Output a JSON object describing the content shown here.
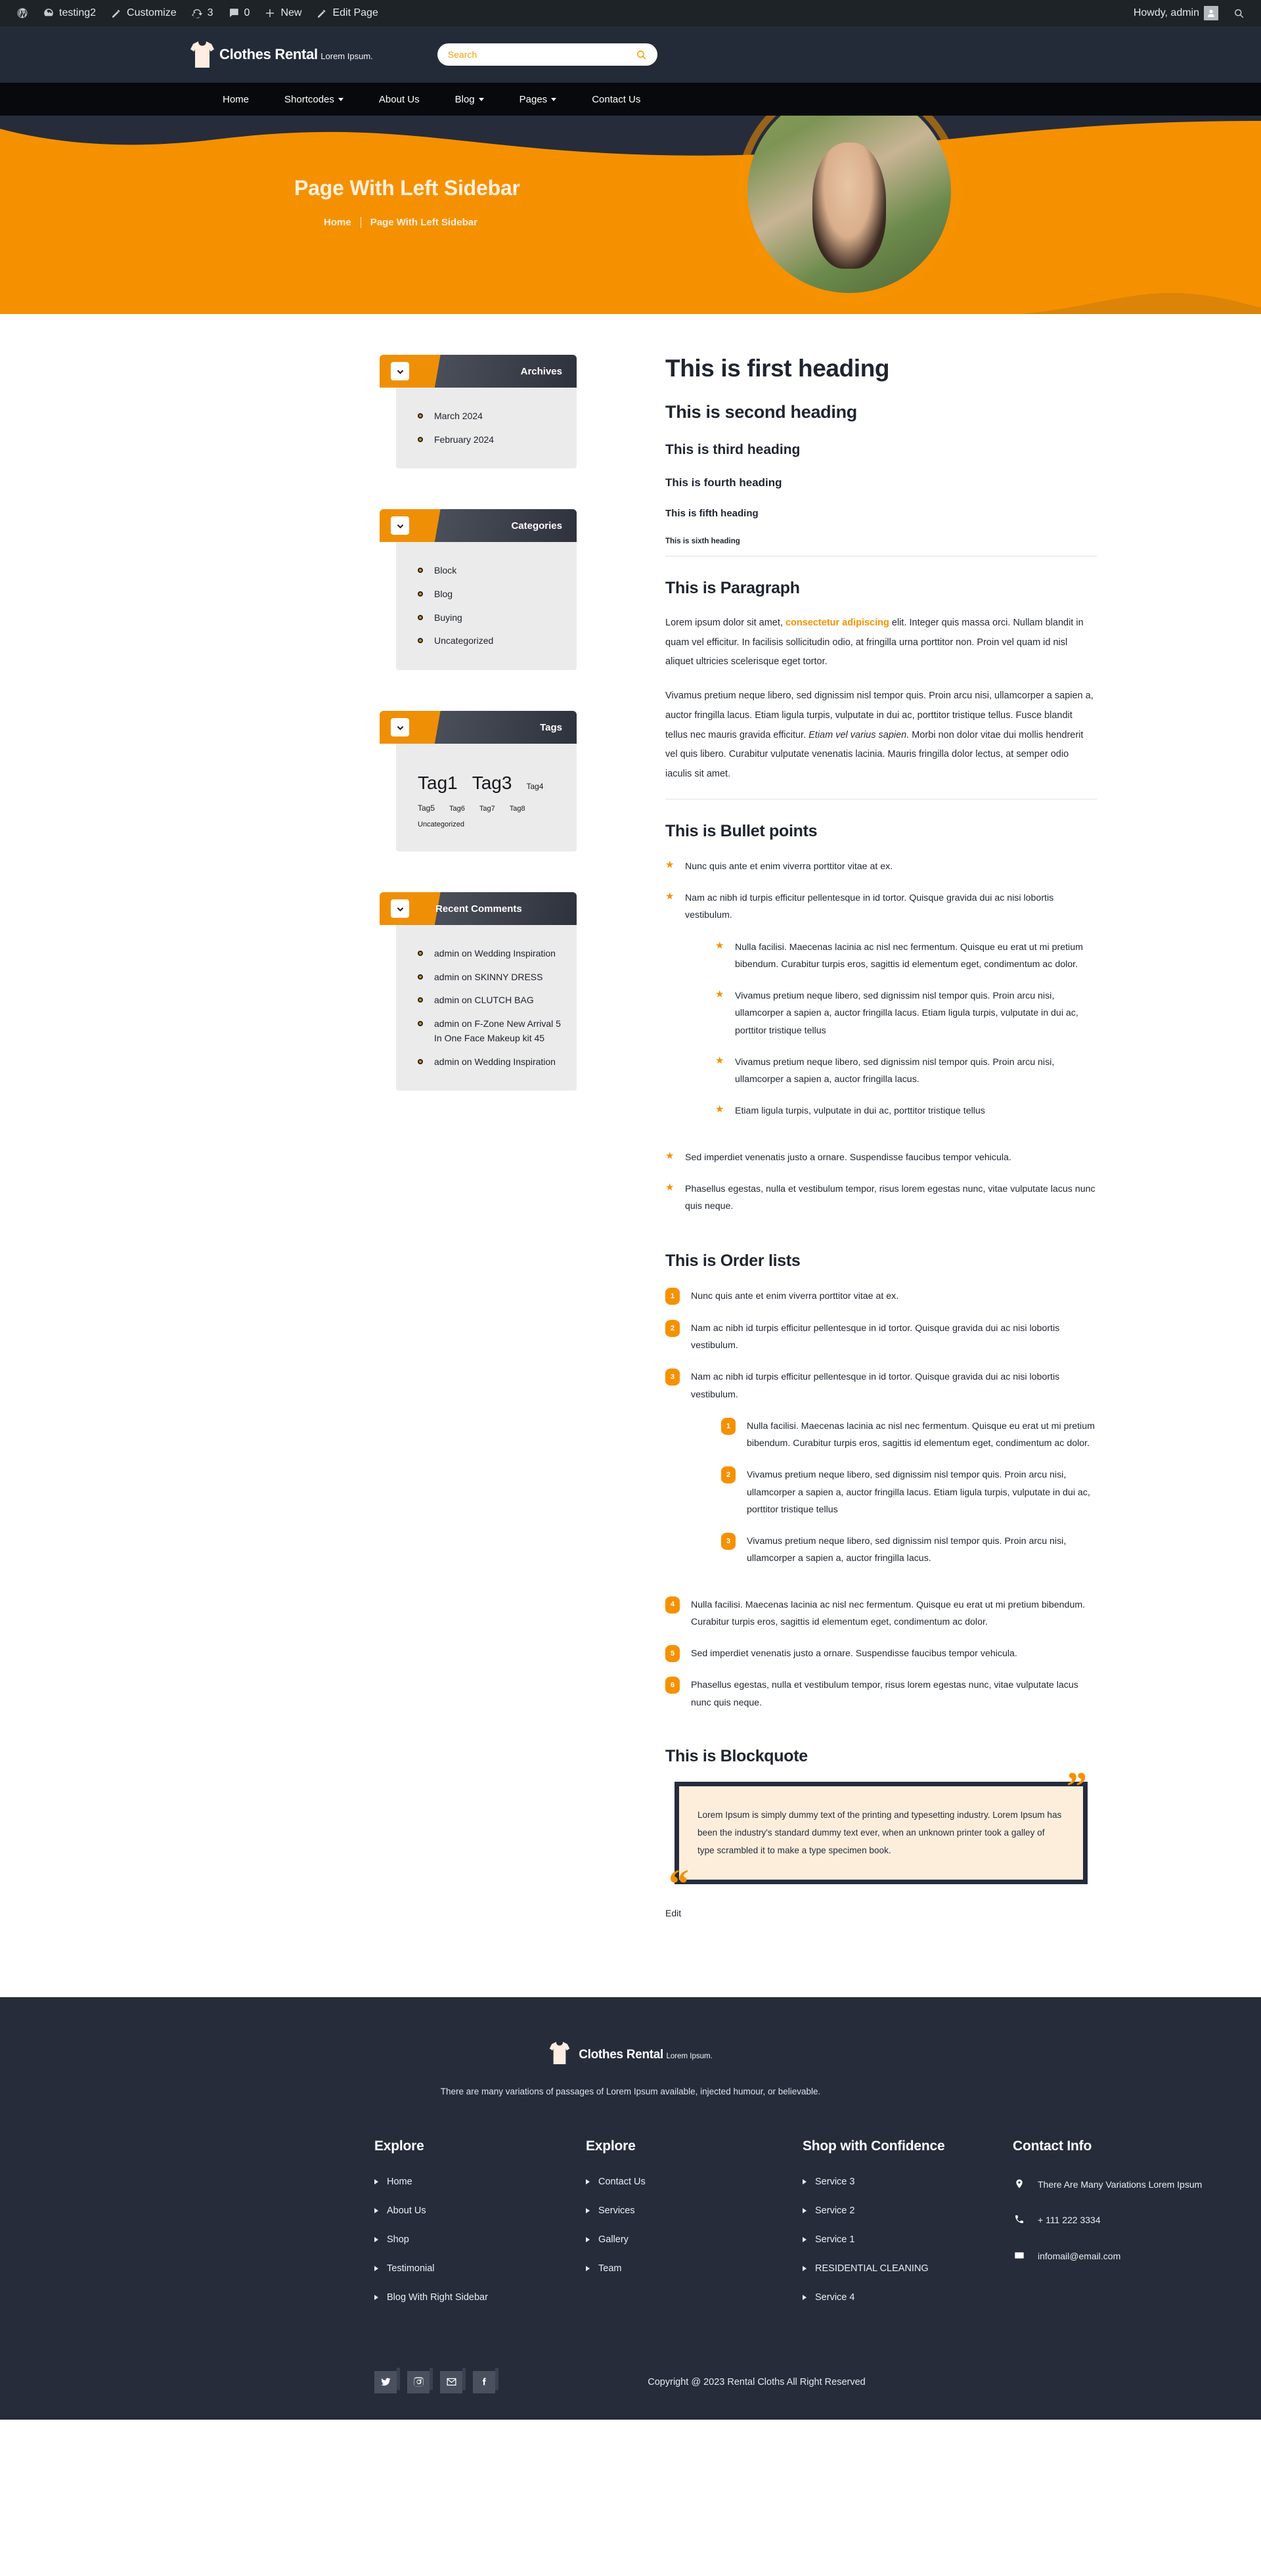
{
  "adminbar": {
    "left": [
      {
        "icon": "wordpress-icon",
        "label": ""
      },
      {
        "icon": "dashboard-icon",
        "label": "testing2"
      },
      {
        "icon": "pencil-icon",
        "label": "Customize"
      },
      {
        "icon": "refresh-icon",
        "label": "3"
      },
      {
        "icon": "comment-icon",
        "label": "0"
      },
      {
        "icon": "plus-icon",
        "label": "New"
      },
      {
        "icon": "edit-icon",
        "label": "Edit Page"
      }
    ],
    "howdy": "Howdy, admin"
  },
  "header": {
    "logo_title": "Clothes Rental",
    "logo_sub": "Lorem Ipsum.",
    "search_placeholder": "Search",
    "search_value": ""
  },
  "nav": {
    "items": [
      {
        "label": "Home",
        "has_caret": false
      },
      {
        "label": "Shortcodes",
        "has_caret": true
      },
      {
        "label": "About Us",
        "has_caret": false
      },
      {
        "label": "Blog",
        "has_caret": true
      },
      {
        "label": "Pages",
        "has_caret": true
      },
      {
        "label": "Contact Us",
        "has_caret": false
      }
    ]
  },
  "hero": {
    "title": "Page With Left Sidebar",
    "crumb_home": "Home",
    "crumb_current": "Page With Left Sidebar"
  },
  "sidebar": {
    "archives": {
      "title": "Archives",
      "items": [
        "March 2024",
        "February 2024"
      ]
    },
    "categories": {
      "title": "Categories",
      "items": [
        "Block",
        "Blog",
        "Buying",
        "Uncategorized"
      ]
    },
    "tags": {
      "title": "Tags",
      "items": [
        {
          "label": "Tag1",
          "size": 28
        },
        {
          "label": "Tag3",
          "size": 28
        },
        {
          "label": "Tag4",
          "size": 12
        },
        {
          "label": "Tag5",
          "size": 12
        },
        {
          "label": "Tag6",
          "size": 11
        },
        {
          "label": "Tag7",
          "size": 11
        },
        {
          "label": "Tag8",
          "size": 11
        },
        {
          "label": "Uncategorized",
          "size": 11
        }
      ]
    },
    "recent_comments": {
      "title": "Recent Comments",
      "items": [
        "admin on Wedding Inspiration",
        "admin on SKINNY DRESS",
        "admin on CLUTCH BAG",
        "admin on F-Zone New Arrival 5 In One Face Makeup kit 45",
        "admin on Wedding Inspiration"
      ]
    }
  },
  "content": {
    "h1": "This is first heading",
    "h2": "This is second heading",
    "h3": "This is third heading",
    "h4": "This is fourth heading",
    "h5": "This is fifth heading",
    "h6": "This is sixth heading",
    "paragraph_title": "This is Paragraph",
    "p1_a": "Lorem ipsum dolor sit amet, ",
    "p1_hl": "consectetur adipiscing",
    "p1_b": " elit. Integer quis massa orci. Nullam blandit in quam vel efficitur. In facilisis sollicitudin odio, at fringilla urna porttitor non. Proin vel quam id nisl aliquet ultricies scelerisque eget tortor.",
    "p2_a": "Vivamus pretium neque libero, sed dignissim nisl tempor quis. Proin arcu nisi, ullamcorper a sapien a, auctor fringilla lacus. Etiam ligula turpis, vulputate in dui ac, porttitor tristique tellus. Fusce blandit tellus nec mauris gravida efficitur. ",
    "p2_ital": "Etiam vel varius sapien.",
    "p2_b": " Morbi non dolor vitae dui mollis hendrerit vel quis libero. Curabitur vulputate venenatis lacinia. Mauris fringilla dolor lectus, at semper odio iaculis sit amet.",
    "bullet_title": "This is Bullet points",
    "bullets": {
      "b1": "Nunc quis ante et enim viverra porttitor vitae at ex.",
      "b2": "Nam ac nibh id turpis efficitur pellentesque in id tortor. Quisque gravida dui ac nisi lobortis vestibulum.",
      "sub1": "Nulla facilisi. Maecenas lacinia ac nisl nec fermentum. Quisque eu erat ut mi pretium bibendum. Curabitur turpis eros, sagittis id elementum eget, condimentum ac dolor.",
      "sub2": "Vivamus pretium neque libero, sed dignissim nisl tempor quis. Proin arcu nisi, ullamcorper a sapien a, auctor fringilla lacus. Etiam ligula turpis, vulputate in dui ac, porttitor tristique tellus",
      "sub3": "Vivamus pretium neque libero, sed dignissim nisl tempor quis. Proin arcu nisi, ullamcorper a sapien a, auctor fringilla lacus.",
      "sub4": "Etiam ligula turpis, vulputate in dui ac, porttitor tristique tellus",
      "b3": "Sed imperdiet venenatis justo a ornare. Suspendisse faucibus tempor vehicula.",
      "b4": "Phasellus egestas, nulla et vestibulum tempor, risus lorem egestas nunc, vitae vulputate lacus nunc quis neque."
    },
    "order_title": "This is Order lists",
    "orders": {
      "o1": "Nunc quis ante et enim viverra porttitor vitae at ex.",
      "o2": "Nam ac nibh id turpis efficitur pellentesque in id tortor. Quisque gravida dui ac nisi lobortis vestibulum.",
      "o3": "Nam ac nibh id turpis efficitur pellentesque in id tortor. Quisque gravida dui ac nisi lobortis vestibulum.",
      "sub1": "Nulla facilisi. Maecenas lacinia ac nisl nec fermentum. Quisque eu erat ut mi pretium bibendum. Curabitur turpis eros, sagittis id elementum eget, condimentum ac dolor.",
      "sub2": "Vivamus pretium neque libero, sed dignissim nisl tempor quis. Proin arcu nisi, ullamcorper a sapien a, auctor fringilla lacus. Etiam ligula turpis, vulputate in dui ac, porttitor tristique tellus",
      "sub3": "Vivamus pretium neque libero, sed dignissim nisl tempor quis. Proin arcu nisi, ullamcorper a sapien a, auctor fringilla lacus.",
      "o4": "Nulla facilisi. Maecenas lacinia ac nisl nec fermentum. Quisque eu erat ut mi pretium bibendum. Curabitur turpis eros, sagittis id elementum eget, condimentum ac dolor.",
      "o5": "Sed imperdiet venenatis justo a ornare. Suspendisse faucibus tempor vehicula.",
      "o6": "Phasellus egestas, nulla et vestibulum tempor, risus lorem egestas nunc, vitae vulputate lacus nunc quis neque.",
      "n1": "1",
      "n2": "2",
      "n3": "3",
      "n4": "4",
      "n5": "5",
      "n6": "6",
      "sn1": "1",
      "sn2": "2",
      "sn3": "3"
    },
    "blockquote_title": "This is Blockquote",
    "blockquote_text": "Lorem Ipsum is simply dummy text of the printing and typesetting industry. Lorem Ipsum has been the industry's standard dummy text ever, when an unknown printer took a galley of type scrambled it to make a type specimen book.",
    "edit_label": "Edit"
  },
  "footer": {
    "logo_title": "Clothes Rental",
    "logo_sub": "Lorem Ipsum.",
    "tagline": "There are many variations of passages of Lorem Ipsum available, injected humour, or believable.",
    "col1": {
      "title": "Explore",
      "items": [
        "Home",
        "About Us",
        "Shop",
        "Testimonial",
        "Blog With Right Sidebar"
      ]
    },
    "col2": {
      "title": "Explore",
      "items": [
        "Contact Us",
        "Services",
        "Gallery",
        "Team"
      ]
    },
    "col3": {
      "title": "Shop with Confidence",
      "items": [
        "Service 3",
        "Service 2",
        "Service 1",
        "RESIDENTIAL CLEANING",
        "Service 4"
      ]
    },
    "col4": {
      "title": "Contact Info",
      "address": "There Are Many Variations Lorem Ipsum",
      "phone": "+ 111 222 3334",
      "email": "infomail@email.com"
    },
    "socials": [
      "twitter-icon",
      "instagram-icon",
      "mail-icon",
      "facebook-icon"
    ],
    "copyright": "Copyright @ 2023 Rental Cloths All Right Reserved"
  },
  "colors": {
    "accent": "#f59100",
    "dark": "#262c3a",
    "nav_black": "#07090c",
    "widget_bg": "#ebebeb"
  }
}
